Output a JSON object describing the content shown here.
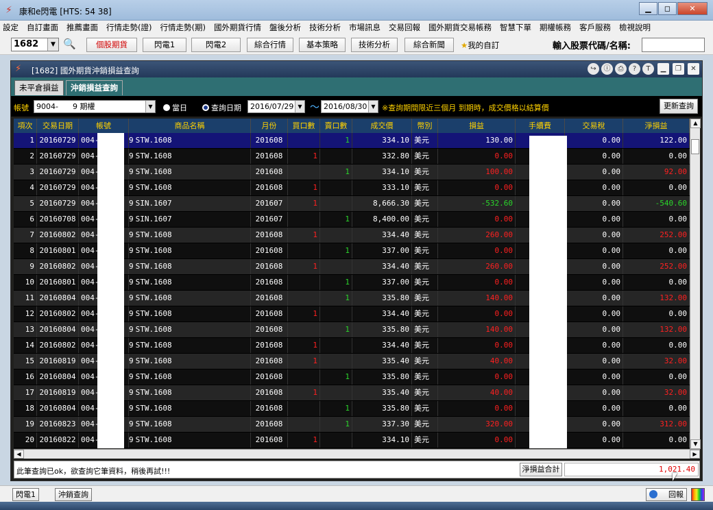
{
  "window": {
    "title": "康和e閃電 [HTS: 54 38]"
  },
  "menu": [
    "設定",
    "自訂畫面",
    "推薦畫面",
    "行情走勢(證)",
    "行情走勢(期)",
    "國外期貨行情",
    "盤後分析",
    "技術分析",
    "市場訊息",
    "交易回報",
    "國外期貨交易帳務",
    "智慧下單",
    "期權帳務",
    "客戶服務",
    "檢視說明"
  ],
  "toolbar": {
    "stock_code": "1682",
    "buttons": [
      "個股期貨",
      "閃電1",
      "閃電2",
      "綜合行情",
      "基本策略",
      "技術分析",
      "綜合新聞"
    ],
    "favorites": "我的自訂",
    "stock_input_label": "輸入股票代碼/名稱:"
  },
  "inner": {
    "title": "[1682] 國外期貨沖銷損益查詢",
    "tabs": [
      "未平倉損益",
      "沖銷損益查詢"
    ],
    "filter": {
      "account_label": "帳號",
      "account_value": "9004-      9 期權",
      "radio_today": "當日",
      "radio_query": "查詢日期",
      "date_from": "2016/07/29",
      "date_to": "2016/08/30",
      "tilde": "～",
      "note": "※查詢期間限近三個月 到期時，成交價格以結算價",
      "refresh": "更新查詢"
    },
    "columns": [
      "項次",
      "交易日期",
      "帳號",
      "商品名稱",
      "月份",
      "買口數",
      "賣口數",
      "成交價",
      "幣別",
      "損益",
      "手續費",
      "交易稅",
      "淨損益"
    ],
    "rows": [
      {
        "no": "1",
        "date": "20160729",
        "acct": "004-",
        "acct_tail": "9",
        "product": "STW.1608",
        "month": "201608",
        "buy": "",
        "sell": "1",
        "price": "334.10",
        "cur": "美元",
        "pl": "130.00",
        "pl_c": "white",
        "tax": "0.00",
        "net": "122.00",
        "net_c": "white"
      },
      {
        "no": "2",
        "date": "20160729",
        "acct": "004-",
        "acct_tail": "9",
        "product": "STW.1608",
        "month": "201608",
        "buy": "1",
        "sell": "",
        "price": "332.80",
        "cur": "美元",
        "pl": "0.00",
        "pl_c": "red",
        "tax": "0.00",
        "net": "0.00",
        "net_c": "white"
      },
      {
        "no": "3",
        "date": "20160729",
        "acct": "004-",
        "acct_tail": "9",
        "product": "STW.1608",
        "month": "201608",
        "buy": "",
        "sell": "1",
        "price": "334.10",
        "cur": "美元",
        "pl": "100.00",
        "pl_c": "red",
        "tax": "0.00",
        "net": "92.00",
        "net_c": "red"
      },
      {
        "no": "4",
        "date": "20160729",
        "acct": "004-",
        "acct_tail": "9",
        "product": "STW.1608",
        "month": "201608",
        "buy": "1",
        "sell": "",
        "price": "333.10",
        "cur": "美元",
        "pl": "0.00",
        "pl_c": "red",
        "tax": "0.00",
        "net": "0.00",
        "net_c": "white"
      },
      {
        "no": "5",
        "date": "20160729",
        "acct": "004-",
        "acct_tail": "9",
        "product": "SIN.1607",
        "month": "201607",
        "buy": "1",
        "sell": "",
        "price": "8,666.30",
        "cur": "美元",
        "pl": "-532.60",
        "pl_c": "green",
        "tax": "0.00",
        "net": "-540.60",
        "net_c": "green"
      },
      {
        "no": "6",
        "date": "20160708",
        "acct": "004-",
        "acct_tail": "9",
        "product": "SIN.1607",
        "month": "201607",
        "buy": "",
        "sell": "1",
        "price": "8,400.00",
        "cur": "美元",
        "pl": "0.00",
        "pl_c": "red",
        "tax": "0.00",
        "net": "0.00",
        "net_c": "white"
      },
      {
        "no": "7",
        "date": "20160802",
        "acct": "004-",
        "acct_tail": "9",
        "product": "STW.1608",
        "month": "201608",
        "buy": "1",
        "sell": "",
        "price": "334.40",
        "cur": "美元",
        "pl": "260.00",
        "pl_c": "red",
        "tax": "0.00",
        "net": "252.00",
        "net_c": "red"
      },
      {
        "no": "8",
        "date": "20160801",
        "acct": "004-",
        "acct_tail": "9",
        "product": "STW.1608",
        "month": "201608",
        "buy": "",
        "sell": "1",
        "price": "337.00",
        "cur": "美元",
        "pl": "0.00",
        "pl_c": "red",
        "tax": "0.00",
        "net": "0.00",
        "net_c": "white"
      },
      {
        "no": "9",
        "date": "20160802",
        "acct": "004-",
        "acct_tail": "9",
        "product": "STW.1608",
        "month": "201608",
        "buy": "1",
        "sell": "",
        "price": "334.40",
        "cur": "美元",
        "pl": "260.00",
        "pl_c": "red",
        "tax": "0.00",
        "net": "252.00",
        "net_c": "red"
      },
      {
        "no": "10",
        "date": "20160801",
        "acct": "004-",
        "acct_tail": "9",
        "product": "STW.1608",
        "month": "201608",
        "buy": "",
        "sell": "1",
        "price": "337.00",
        "cur": "美元",
        "pl": "0.00",
        "pl_c": "red",
        "tax": "0.00",
        "net": "0.00",
        "net_c": "white"
      },
      {
        "no": "11",
        "date": "20160804",
        "acct": "004-",
        "acct_tail": "9",
        "product": "STW.1608",
        "month": "201608",
        "buy": "",
        "sell": "1",
        "price": "335.80",
        "cur": "美元",
        "pl": "140.00",
        "pl_c": "red",
        "tax": "0.00",
        "net": "132.00",
        "net_c": "red"
      },
      {
        "no": "12",
        "date": "20160802",
        "acct": "004-",
        "acct_tail": "9",
        "product": "STW.1608",
        "month": "201608",
        "buy": "1",
        "sell": "",
        "price": "334.40",
        "cur": "美元",
        "pl": "0.00",
        "pl_c": "red",
        "tax": "0.00",
        "net": "0.00",
        "net_c": "white"
      },
      {
        "no": "13",
        "date": "20160804",
        "acct": "004-",
        "acct_tail": "9",
        "product": "STW.1608",
        "month": "201608",
        "buy": "",
        "sell": "1",
        "price": "335.80",
        "cur": "美元",
        "pl": "140.00",
        "pl_c": "red",
        "tax": "0.00",
        "net": "132.00",
        "net_c": "red"
      },
      {
        "no": "14",
        "date": "20160802",
        "acct": "004-",
        "acct_tail": "9",
        "product": "STW.1608",
        "month": "201608",
        "buy": "1",
        "sell": "",
        "price": "334.40",
        "cur": "美元",
        "pl": "0.00",
        "pl_c": "red",
        "tax": "0.00",
        "net": "0.00",
        "net_c": "white"
      },
      {
        "no": "15",
        "date": "20160819",
        "acct": "004-",
        "acct_tail": "9",
        "product": "STW.1608",
        "month": "201608",
        "buy": "1",
        "sell": "",
        "price": "335.40",
        "cur": "美元",
        "pl": "40.00",
        "pl_c": "red",
        "tax": "0.00",
        "net": "32.00",
        "net_c": "red"
      },
      {
        "no": "16",
        "date": "20160804",
        "acct": "004-",
        "acct_tail": "9",
        "product": "STW.1608",
        "month": "201608",
        "buy": "",
        "sell": "1",
        "price": "335.80",
        "cur": "美元",
        "pl": "0.00",
        "pl_c": "red",
        "tax": "0.00",
        "net": "0.00",
        "net_c": "white"
      },
      {
        "no": "17",
        "date": "20160819",
        "acct": "004-",
        "acct_tail": "9",
        "product": "STW.1608",
        "month": "201608",
        "buy": "1",
        "sell": "",
        "price": "335.40",
        "cur": "美元",
        "pl": "40.00",
        "pl_c": "red",
        "tax": "0.00",
        "net": "32.00",
        "net_c": "red"
      },
      {
        "no": "18",
        "date": "20160804",
        "acct": "004-",
        "acct_tail": "9",
        "product": "STW.1608",
        "month": "201608",
        "buy": "",
        "sell": "1",
        "price": "335.80",
        "cur": "美元",
        "pl": "0.00",
        "pl_c": "red",
        "tax": "0.00",
        "net": "0.00",
        "net_c": "white"
      },
      {
        "no": "19",
        "date": "20160823",
        "acct": "004-",
        "acct_tail": "9",
        "product": "STW.1608",
        "month": "201608",
        "buy": "",
        "sell": "1",
        "price": "337.30",
        "cur": "美元",
        "pl": "320.00",
        "pl_c": "red",
        "tax": "0.00",
        "net": "312.00",
        "net_c": "red"
      },
      {
        "no": "20",
        "date": "20160822",
        "acct": "004-",
        "acct_tail": "9",
        "product": "STW.1608",
        "month": "201608",
        "buy": "1",
        "sell": "",
        "price": "334.10",
        "cur": "美元",
        "pl": "0.00",
        "pl_c": "red",
        "tax": "0.00",
        "net": "0.00",
        "net_c": "white"
      }
    ],
    "status": {
      "message": "此筆查詢已ok，欲查詢它筆資料，稍後再試!!!",
      "sum_label": "淨損益合計",
      "sum_value": "1,021.40"
    }
  },
  "taskbar": {
    "tabs": [
      "閃電1",
      "沖銷查詢"
    ],
    "return_label": "回報"
  },
  "colors": {
    "red": "#ff2020",
    "green": "#2bd62b",
    "header": "#ffd200",
    "selected_row": "#141477"
  }
}
